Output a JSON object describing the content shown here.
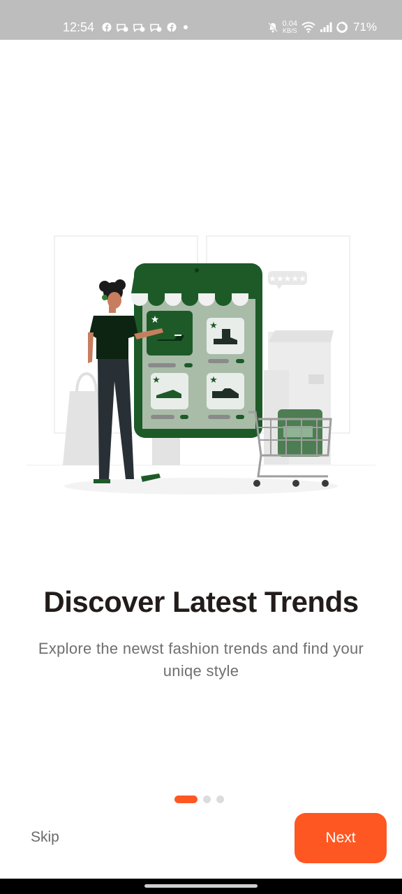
{
  "status_bar": {
    "time": "12:54",
    "net_speed_value": "0.04",
    "net_speed_unit": "KB/S",
    "battery": "71%",
    "icons": [
      "facebook-icon",
      "messenger-icon",
      "messenger-icon",
      "messenger-icon",
      "facebook-icon",
      "notification-dot-icon",
      "bell-off-icon",
      "wifi-icon",
      "signal-icon",
      "battery-icon"
    ]
  },
  "onboarding": {
    "illustration": "shopping-illustration",
    "title": "Discover Latest Trends",
    "subtitle": "Explore the newst fashion trends and find your uniqe style",
    "page_indicator": {
      "current": 1,
      "total": 3
    }
  },
  "actions": {
    "skip_label": "Skip",
    "next_label": "Next"
  },
  "colors": {
    "accent": "#fe5722",
    "brand_green": "#1d5a28",
    "title_text": "#221c1a",
    "subtitle_text": "#6f6f6f"
  }
}
